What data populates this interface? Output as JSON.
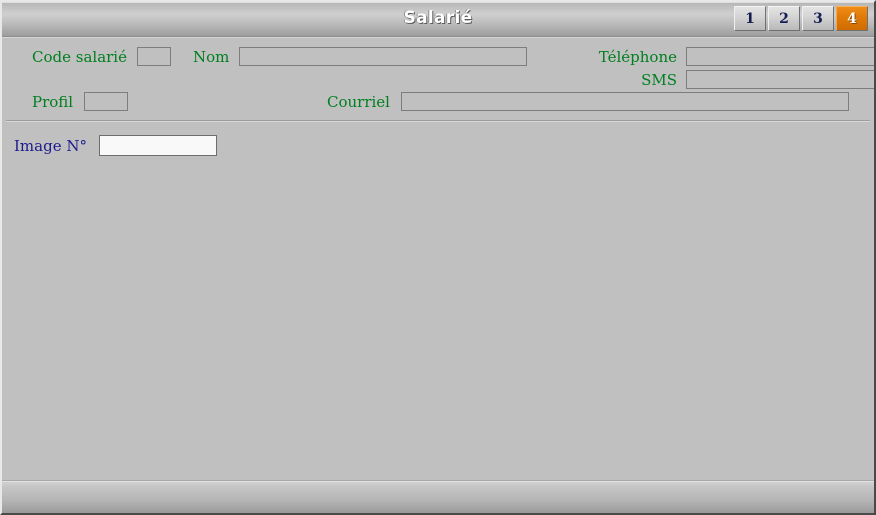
{
  "window": {
    "title": "Salarié",
    "background_color": "#c0c0c0"
  },
  "tabs": {
    "items": [
      {
        "label": "1",
        "active": false
      },
      {
        "label": "2",
        "active": false
      },
      {
        "label": "3",
        "active": false
      },
      {
        "label": "4",
        "active": true
      }
    ],
    "active_color": "#d96c08",
    "inactive_text_color": "#151c52"
  },
  "form": {
    "label_color": "#007f1f",
    "focus_label_color": "#1b1b8f",
    "fields": {
      "code_salarie": {
        "label": "Code salarié",
        "value": "",
        "placeholder": ""
      },
      "nom": {
        "label": "Nom",
        "value": "",
        "placeholder": ""
      },
      "telephone": {
        "label": "Téléphone",
        "value": "",
        "placeholder": ""
      },
      "sms": {
        "label": "SMS",
        "value": "",
        "placeholder": ""
      },
      "profil": {
        "label": "Profil",
        "value": "",
        "placeholder": ""
      },
      "courriel": {
        "label": "Courriel",
        "value": "",
        "placeholder": ""
      },
      "image_no": {
        "label": "Image N°",
        "value": "",
        "placeholder": ""
      }
    }
  },
  "statusbar": {
    "text": ""
  }
}
